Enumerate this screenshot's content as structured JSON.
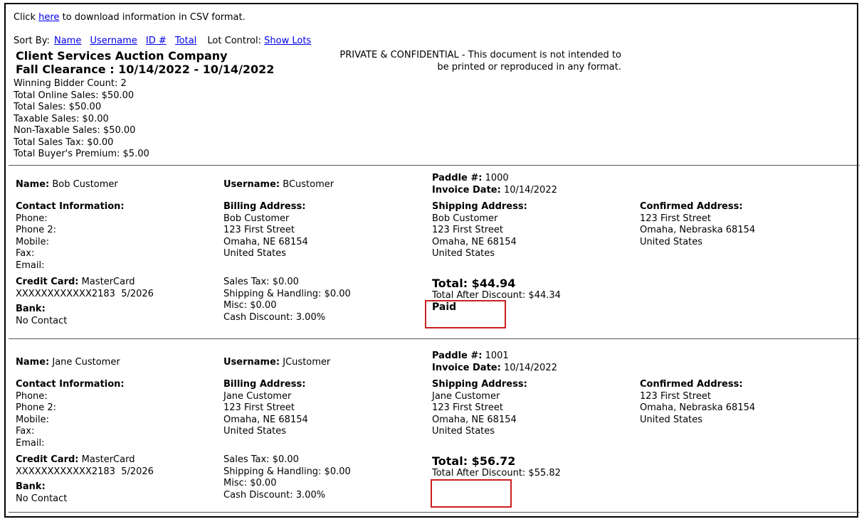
{
  "header": {
    "csv_prefix": "Click",
    "csv_link": "here",
    "csv_suffix": "to download information in CSV format.",
    "sort_by_label": "Sort By:",
    "sort_links": [
      "Name",
      "Username",
      "ID #",
      "Total"
    ],
    "lot_control_label": "Lot Control:",
    "show_lots_link": "Show Lots",
    "company": "Client Services Auction Company",
    "sale_title": "Fall Clearance : 10/14/2022 - 10/14/2022",
    "confidential_line1": "PRIVATE & CONFIDENTIAL - This document is not intended to",
    "confidential_line2": "be printed or reproduced in any format.",
    "stats": [
      "Winning Bidder Count: 2",
      "Total Online Sales: $50.00",
      "Total Sales: $50.00",
      "Taxable Sales: $0.00",
      "Non-Taxable Sales: $50.00",
      "Total Sales Tax: $0.00",
      "Total Buyer's Premium: $5.00"
    ]
  },
  "labels": {
    "name": "Name:",
    "username": "Username:",
    "paddle": "Paddle #:",
    "invoice_date": "Invoice Date:",
    "contact_info": "Contact Information:",
    "billing_address": "Billing Address:",
    "shipping_address": "Shipping Address:",
    "confirmed_address": "Confirmed Address:",
    "phone": "Phone:",
    "phone2": "Phone 2:",
    "mobile": "Mobile:",
    "fax": "Fax:",
    "email": "Email:",
    "credit_card": "Credit Card:",
    "bank": "Bank:"
  },
  "bidders": [
    {
      "name": "Bob Customer",
      "username": "BCustomer",
      "paddle": "1000",
      "invoice_date": "10/14/2022",
      "billing": [
        "Bob Customer",
        "123 First Street",
        "Omaha, NE 68154",
        "United States"
      ],
      "shipping": [
        "Bob Customer",
        "123 First Street",
        "Omaha, NE 68154",
        "United States"
      ],
      "confirmed": [
        "123 First Street",
        "Omaha, Nebraska 68154",
        "United States"
      ],
      "card_type": "MasterCard",
      "card_number": "XXXXXXXXXXXX2183  5/2026",
      "bank": "No Contact",
      "sales_tax": "Sales Tax: $0.00",
      "shipping_handling": "Shipping & Handling: $0.00",
      "misc": "Misc: $0.00",
      "cash_discount": "Cash Discount: 3.00%",
      "total": "Total: $44.94",
      "total_after_discount": "Total After Discount: $44.34",
      "status": "Paid"
    },
    {
      "name": "Jane Customer",
      "username": "JCustomer",
      "paddle": "1001",
      "invoice_date": "10/14/2022",
      "billing": [
        "Jane Customer",
        "123 First Street",
        "Omaha, NE 68154",
        "United States"
      ],
      "shipping": [
        "Jane Customer",
        "123 First Street",
        "Omaha, NE 68154",
        "United States"
      ],
      "confirmed": [
        "123 First Street",
        "Omaha, Nebraska 68154",
        "United States"
      ],
      "card_type": "MasterCard",
      "card_number": "XXXXXXXXXXXX2183  5/2026",
      "bank": "No Contact",
      "sales_tax": "Sales Tax: $0.00",
      "shipping_handling": "Shipping & Handling: $0.00",
      "misc": "Misc: $0.00",
      "cash_discount": "Cash Discount: 3.00%",
      "total": "Total: $56.72",
      "total_after_discount": "Total After Discount: $55.82",
      "status": ""
    }
  ],
  "colors": {
    "link": "#0000ee",
    "highlight_box": "#cc1f1f",
    "border": "#000000"
  }
}
